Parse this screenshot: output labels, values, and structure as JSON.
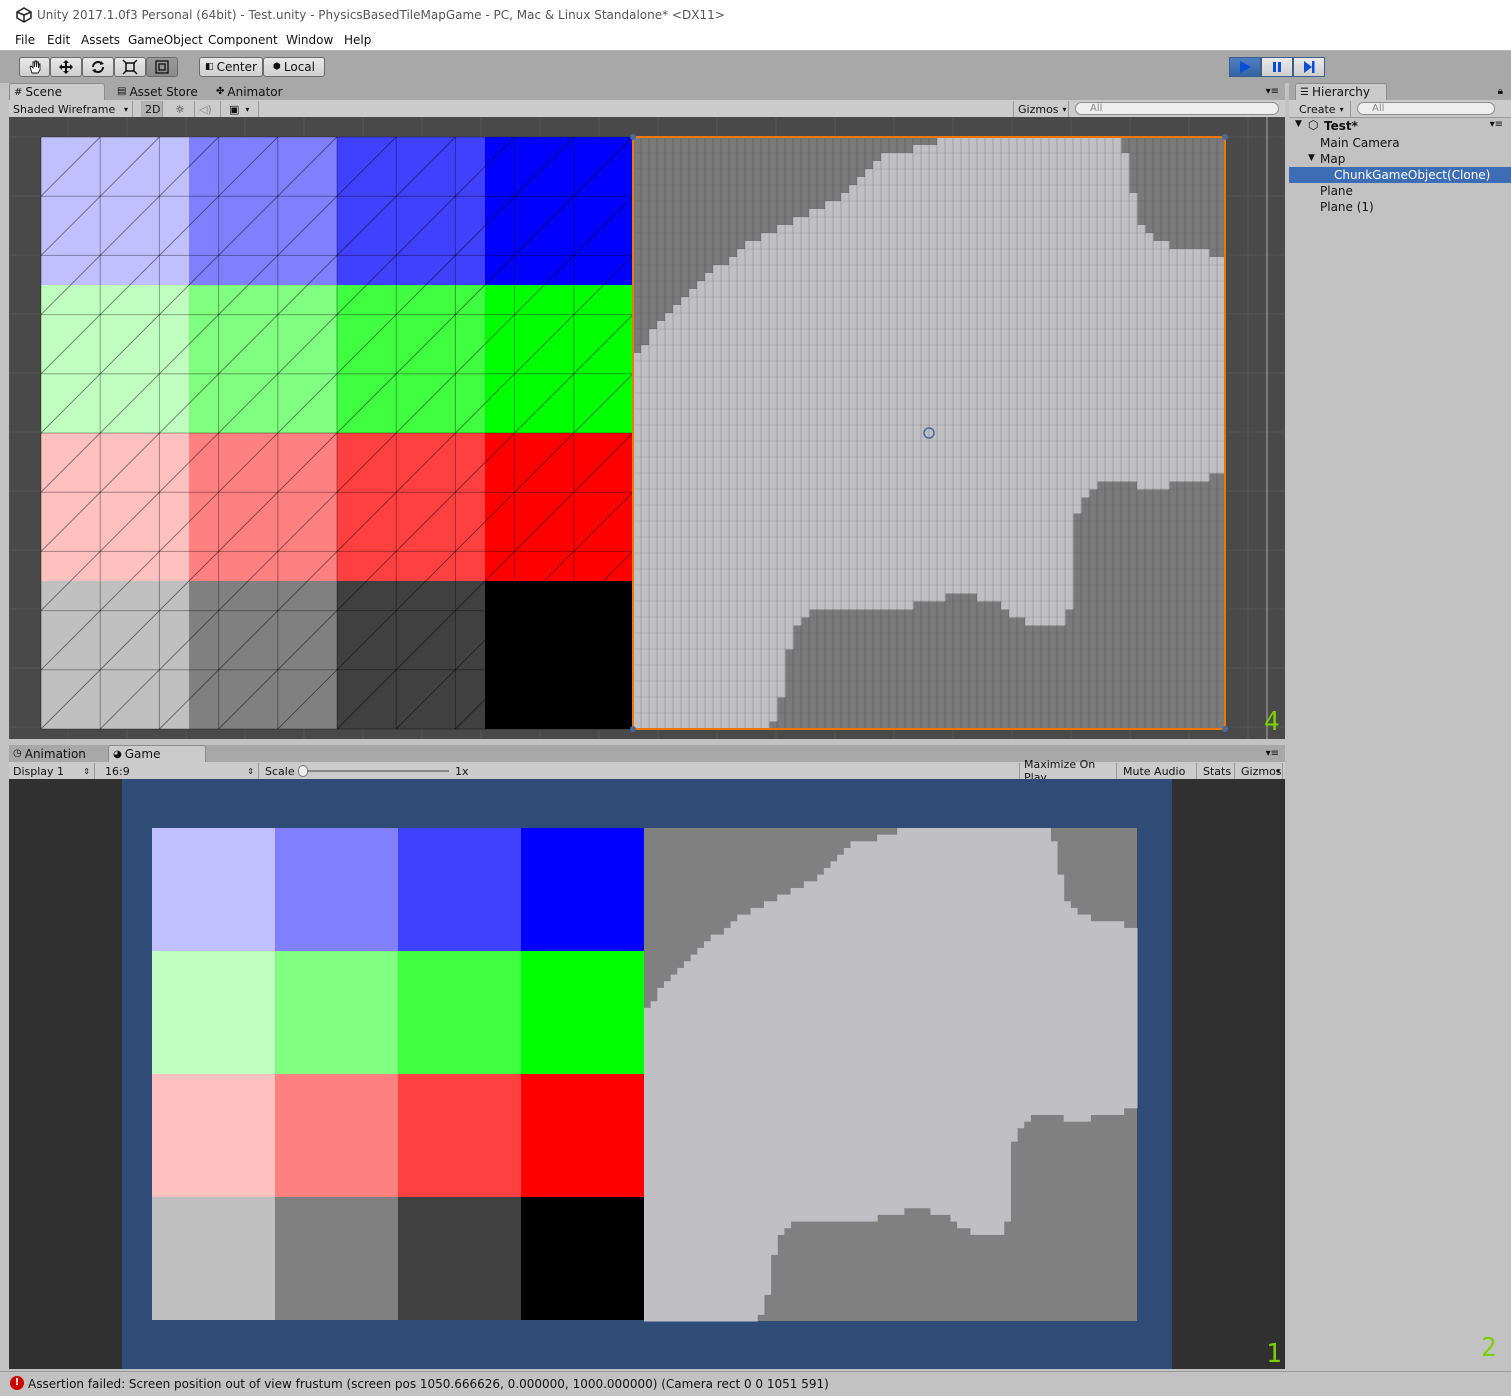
{
  "window": {
    "title": "Unity 2017.1.0f3 Personal (64bit) - Test.unity - PhysicsBasedTileMapGame - PC, Mac & Linux Standalone* <DX11>"
  },
  "menu": [
    "File",
    "Edit",
    "Assets",
    "GameObject",
    "Component",
    "Window",
    "Help"
  ],
  "toolbar": {
    "tools": [
      "hand-icon",
      "move-icon",
      "rotate-icon",
      "scale-icon",
      "rect-icon"
    ],
    "pivot": "Center",
    "space": "Local"
  },
  "scene_tabs": [
    "Scene",
    "Asset Store",
    "Animator"
  ],
  "scene_toolbar": {
    "shading": "Shaded Wireframe",
    "mode2d": "2D",
    "gizmos": "Gizmos",
    "search_placeholder": "All"
  },
  "hierarchy": {
    "tab": "Hierarchy",
    "create": "Create",
    "search_placeholder": "All",
    "scene": "Test*",
    "items": [
      {
        "label": "Main Camera",
        "indent": 1
      },
      {
        "label": "Map",
        "indent": 1
      },
      {
        "label": "ChunkGameObject(Clone)",
        "indent": 2,
        "selected": true
      },
      {
        "label": "Plane",
        "indent": 1
      },
      {
        "label": "Plane (1)",
        "indent": 1
      }
    ]
  },
  "game_tabs": [
    "Animation",
    "Game"
  ],
  "game_toolbar": {
    "display": "Display 1",
    "aspect": "16:9",
    "scale_label": "Scale",
    "scale_value": "1x",
    "maximize": "Maximize On Play",
    "mute": "Mute Audio",
    "stats": "Stats",
    "gizmos": "Gizmos"
  },
  "color_grid": {
    "rows": [
      [
        "#c0c0ff",
        "#8080ff",
        "#4040ff",
        "#0000ff"
      ],
      [
        "#c0ffc0",
        "#80ff80",
        "#40ff40",
        "#00ff00"
      ],
      [
        "#ffc0c0",
        "#ff8080",
        "#ff4040",
        "#ff0000"
      ],
      [
        "#c0c0c0",
        "#808080",
        "#404040",
        "#000000"
      ]
    ]
  },
  "colors": {
    "selection": "#3d6eb5",
    "game_bg": "#2e4c75",
    "map_dark": "#808080",
    "map_light": "#c0c0c4",
    "select_outline": "#f07800",
    "label_green": "#7ccf00"
  },
  "overlay_numbers": {
    "scene": "4",
    "game": "1",
    "hierarchy": "2"
  },
  "status": {
    "message": "Assertion failed: Screen position out of view frustum (screen pos 1050.666626, 0.000000, 1000.000000) (Camera rect 0 0 1051 591)"
  }
}
